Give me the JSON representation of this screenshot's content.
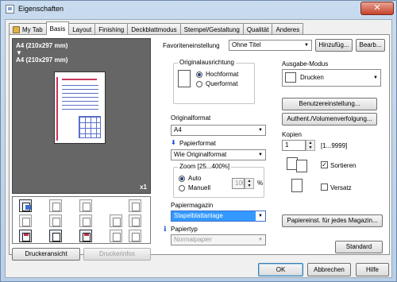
{
  "window": {
    "title": "Eigenschaften",
    "close_glyph": "✕"
  },
  "tabs": [
    {
      "label": "My Tab"
    },
    {
      "label": "Basis"
    },
    {
      "label": "Layout"
    },
    {
      "label": "Finishing"
    },
    {
      "label": "Deckblattmodus"
    },
    {
      "label": "Stempel/Gestaltung"
    },
    {
      "label": "Qualität"
    },
    {
      "label": "Anderes"
    }
  ],
  "preview": {
    "line1": "A4 (210x297 mm)",
    "arrow": "▼",
    "line2": "A4 (210x297 mm)",
    "count": "x1"
  },
  "left_buttons": {
    "printer_view": "Druckeransicht",
    "printer_info": "Druckerinfos"
  },
  "favorites": {
    "label": "Favoriteneinstellung",
    "value": "Ohne Titel",
    "add": "Hinzufüg...",
    "edit": "Bearb..."
  },
  "orientation": {
    "title": "Originalausrichtung",
    "portrait": "Hochformat",
    "landscape": "Querformat",
    "selected": "Hochformat"
  },
  "original_format": {
    "label": "Originalformat",
    "value": "A4"
  },
  "paper_format": {
    "label": "Papierformat",
    "value": "Wie Originalformat"
  },
  "zoom": {
    "title": "Zoom [25...400%]",
    "auto": "Auto",
    "manual": "Manuell",
    "value": "100",
    "unit": "%",
    "selected": "Auto"
  },
  "paper_tray": {
    "label": "Papiermagazin",
    "value": "Stapelblattanlage"
  },
  "paper_type": {
    "label": "Papiertyp",
    "value": "Normalpapier"
  },
  "output_mode": {
    "label": "Ausgabe-Modus",
    "value": "Drucken"
  },
  "right_buttons": {
    "user_settings": "Benutzereinstellung...",
    "auth": "Authent./Volumenverfolgung...",
    "paper_per_tray": "Papiereinst. für jedes Magazin...",
    "standard": "Standard"
  },
  "copies": {
    "label": "Kopien",
    "value": "1",
    "range": "[1...9999]"
  },
  "collate": {
    "label": "Sortieren",
    "checked": true,
    "check_glyph": "✓"
  },
  "offset": {
    "label": "Versatz",
    "checked": false
  },
  "dialog": {
    "ok": "OK",
    "cancel": "Abbrechen",
    "help": "Hilfe"
  },
  "colors": {
    "accent": "#3399ff",
    "preview_bg": "#666666",
    "selection": "#3399ff"
  }
}
